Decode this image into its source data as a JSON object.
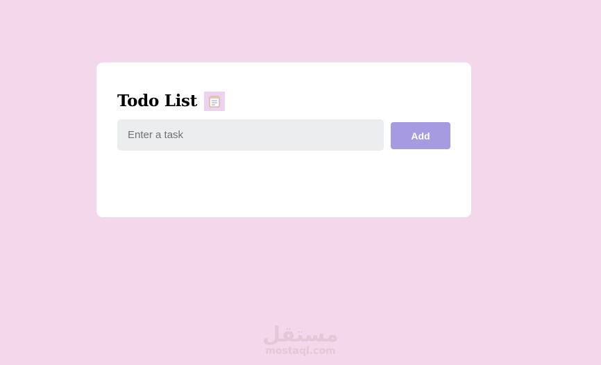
{
  "colors": {
    "background": "#f3d7ea",
    "card": "#ffffff",
    "input_background": "#ecedef",
    "accent": "#a69ae0"
  },
  "todo": {
    "title": "Todo List",
    "title_icon": "notepad-icon",
    "input": {
      "placeholder": "Enter a task",
      "value": ""
    },
    "add_label": "Add",
    "tasks": []
  },
  "watermark": {
    "logo_text": "مستقل",
    "site": "mostaql.com"
  }
}
